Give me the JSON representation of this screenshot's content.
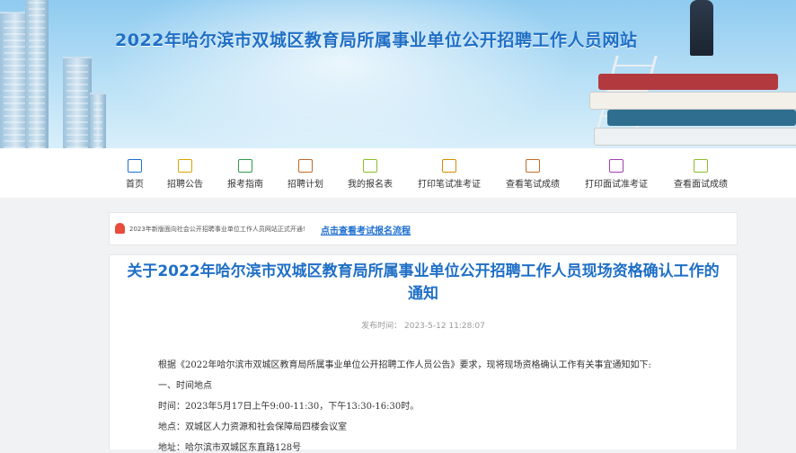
{
  "site": {
    "title": "2022年哈尔滨市双城区教育局所属事业单位公开招聘工作人员网站"
  },
  "nav": [
    {
      "label": "首页",
      "icon": "monitor-icon",
      "color": "#1e6fd0"
    },
    {
      "label": "招聘公告",
      "icon": "clipboard-icon",
      "color": "#d9a400"
    },
    {
      "label": "报考指南",
      "icon": "guide-icon",
      "color": "#2e9b47"
    },
    {
      "label": "招聘计划",
      "icon": "document-icon",
      "color": "#c0692a"
    },
    {
      "label": "我的报名表",
      "icon": "form-icon",
      "color": "#8bbd28"
    },
    {
      "label": "打印笔试准考证",
      "icon": "id-card-icon",
      "color": "#d98b00"
    },
    {
      "label": "查看笔试成绩",
      "icon": "book-icon",
      "color": "#c46b2c"
    },
    {
      "label": "打印面试准考证",
      "icon": "printer-icon",
      "color": "#a43fb3"
    },
    {
      "label": "查看面试成绩",
      "icon": "search-doc-icon",
      "color": "#8bbd28"
    }
  ],
  "notice": {
    "text": "2023年新版面向社会公开招聘事业单位工作人员网站正式开通!",
    "link": "点击查看考试报名流程"
  },
  "article": {
    "title_line1": "关于2022年哈尔滨市双城区教育局所属事业单位公开招聘工作人员现场资格确认工作的",
    "title_line2": "通知",
    "published": "发布时间：  2023-5-12 11:28:07",
    "paragraphs": [
      "根据《2022年哈尔滨市双城区教育局所属事业单位公开招聘工作人员公告》要求，现将现场资格确认工作有关事宜通知如下:",
      "一、时间地点",
      "时间：2023年5月17日上午9:00-11:30，下午13:30-16:30时。",
      "地点：双城区人力资源和社会保障局四楼会议室",
      "地址：哈尔滨市双城区东直路128号"
    ]
  }
}
